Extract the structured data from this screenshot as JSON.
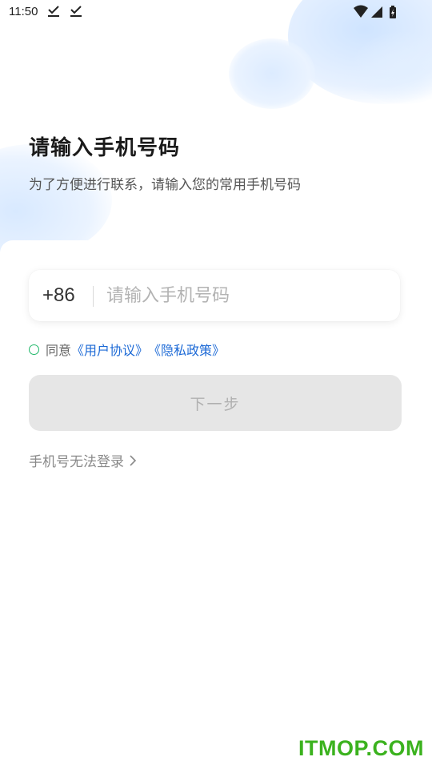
{
  "status_bar": {
    "time": "11:50",
    "icons": [
      "download-done-icon",
      "download-done-icon",
      "wifi-icon",
      "signal-icon",
      "battery-icon"
    ]
  },
  "header": {
    "title": "请输入手机号码",
    "subtitle": "为了方便进行联系，请输入您的常用手机号码"
  },
  "phone_form": {
    "country_code": "+86",
    "phone_placeholder": "请输入手机号码",
    "phone_value": ""
  },
  "agreement": {
    "checked": false,
    "prefix": "同意",
    "user_agreement": "《用户协议》",
    "privacy_policy": "《隐私政策》"
  },
  "next_button": {
    "label": "下一步",
    "enabled": false
  },
  "cannot_login": {
    "label": "手机号无法登录"
  },
  "watermark": {
    "text": "ITMOP.COM"
  },
  "colors": {
    "accent_link": "#1d6ad6",
    "radio_green": "#20b86a",
    "button_disabled_bg": "#e6e6e6",
    "watermark_green": "#3bb21e"
  }
}
